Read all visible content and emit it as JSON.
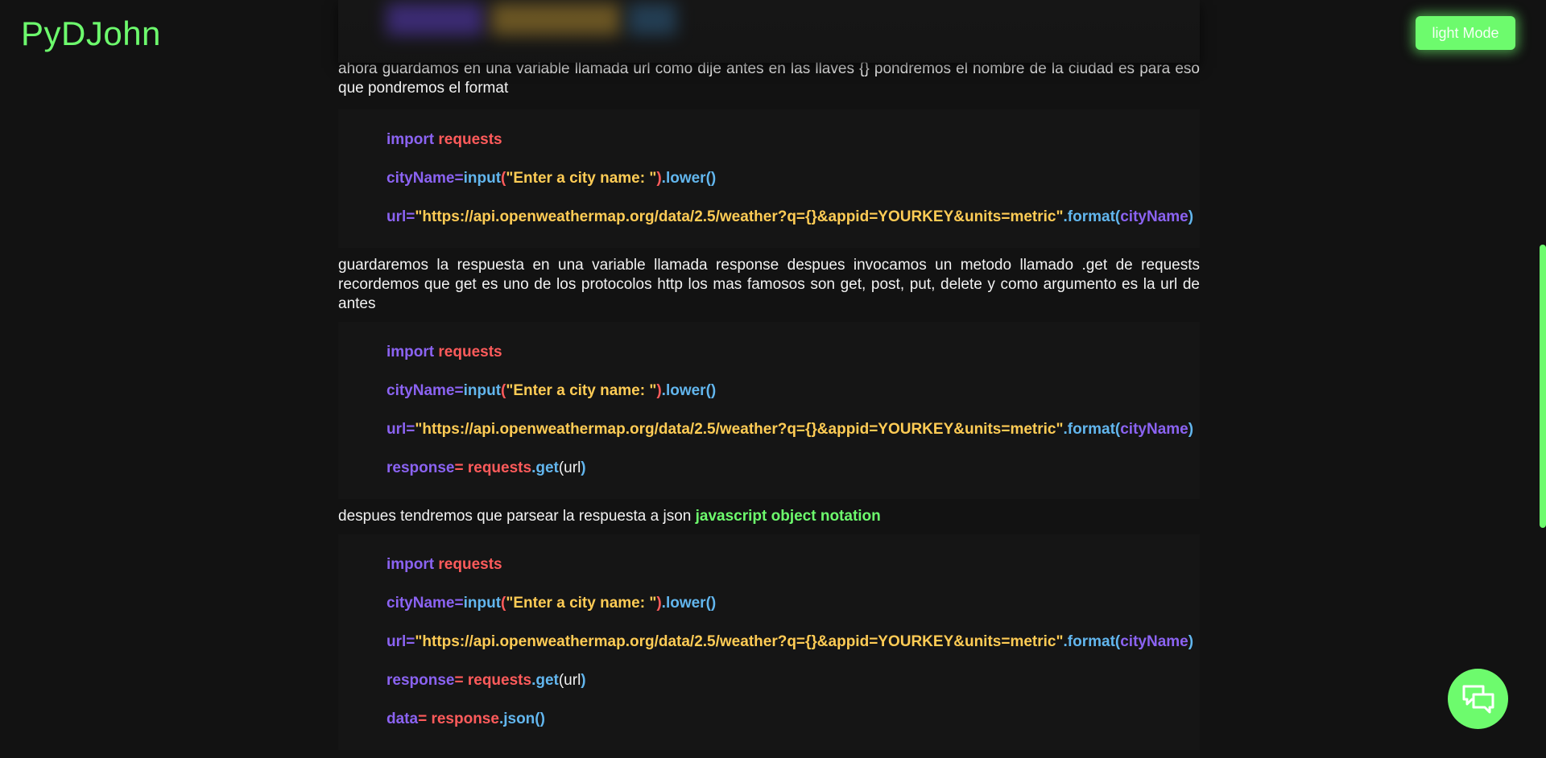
{
  "header": {
    "brand": "PyDJohn",
    "theme_toggle_label": "light Mode"
  },
  "colors": {
    "accent": "#6dfb6d",
    "background": "#121212",
    "keyword_purple": "#8b63f2",
    "keyword_red": "#ff5b5b",
    "keyword_blue": "#62b6ee",
    "string_yellow": "#ffcc55"
  },
  "article": {
    "p1": "ahora guardamos en una variable llamada url como dije antes en las llaves {} pondremos el nombre de la ciudad es para eso que pondremos el format",
    "p2": "guardaremos la respuesta en una variable llamada response despues invocamos un metodo llamado .get de requests recordemos que get es uno de los protocolos http los mas famosos son get, post, put, delete y como argumento es la url de antes",
    "p3_text": "despues tendremos que parsear la respuesta a json ",
    "p3_highlight": "javascript object notation"
  },
  "code": {
    "import_kw": "import",
    "requests": "requests",
    "cityName": "cityName",
    "eq": "=",
    "input": "input",
    "open_paren": "(",
    "prompt_str": "\"Enter a city name: \"",
    "close_paren": ")",
    "dot": ".",
    "lower": "lower()",
    "url_var": "url",
    "url_str": "\"https://api.openweathermap.org/data/2.5/weather?q={}&appid=YOURKEY&units=metric\"",
    "format": "format",
    "response_var": "response",
    "eq_space": "= ",
    "get": "get",
    "url_arg": "url",
    "data_var": "data",
    "response_obj": "response",
    "json_call": "json()"
  },
  "icons": {
    "chat": "chat-bubbles-icon"
  }
}
